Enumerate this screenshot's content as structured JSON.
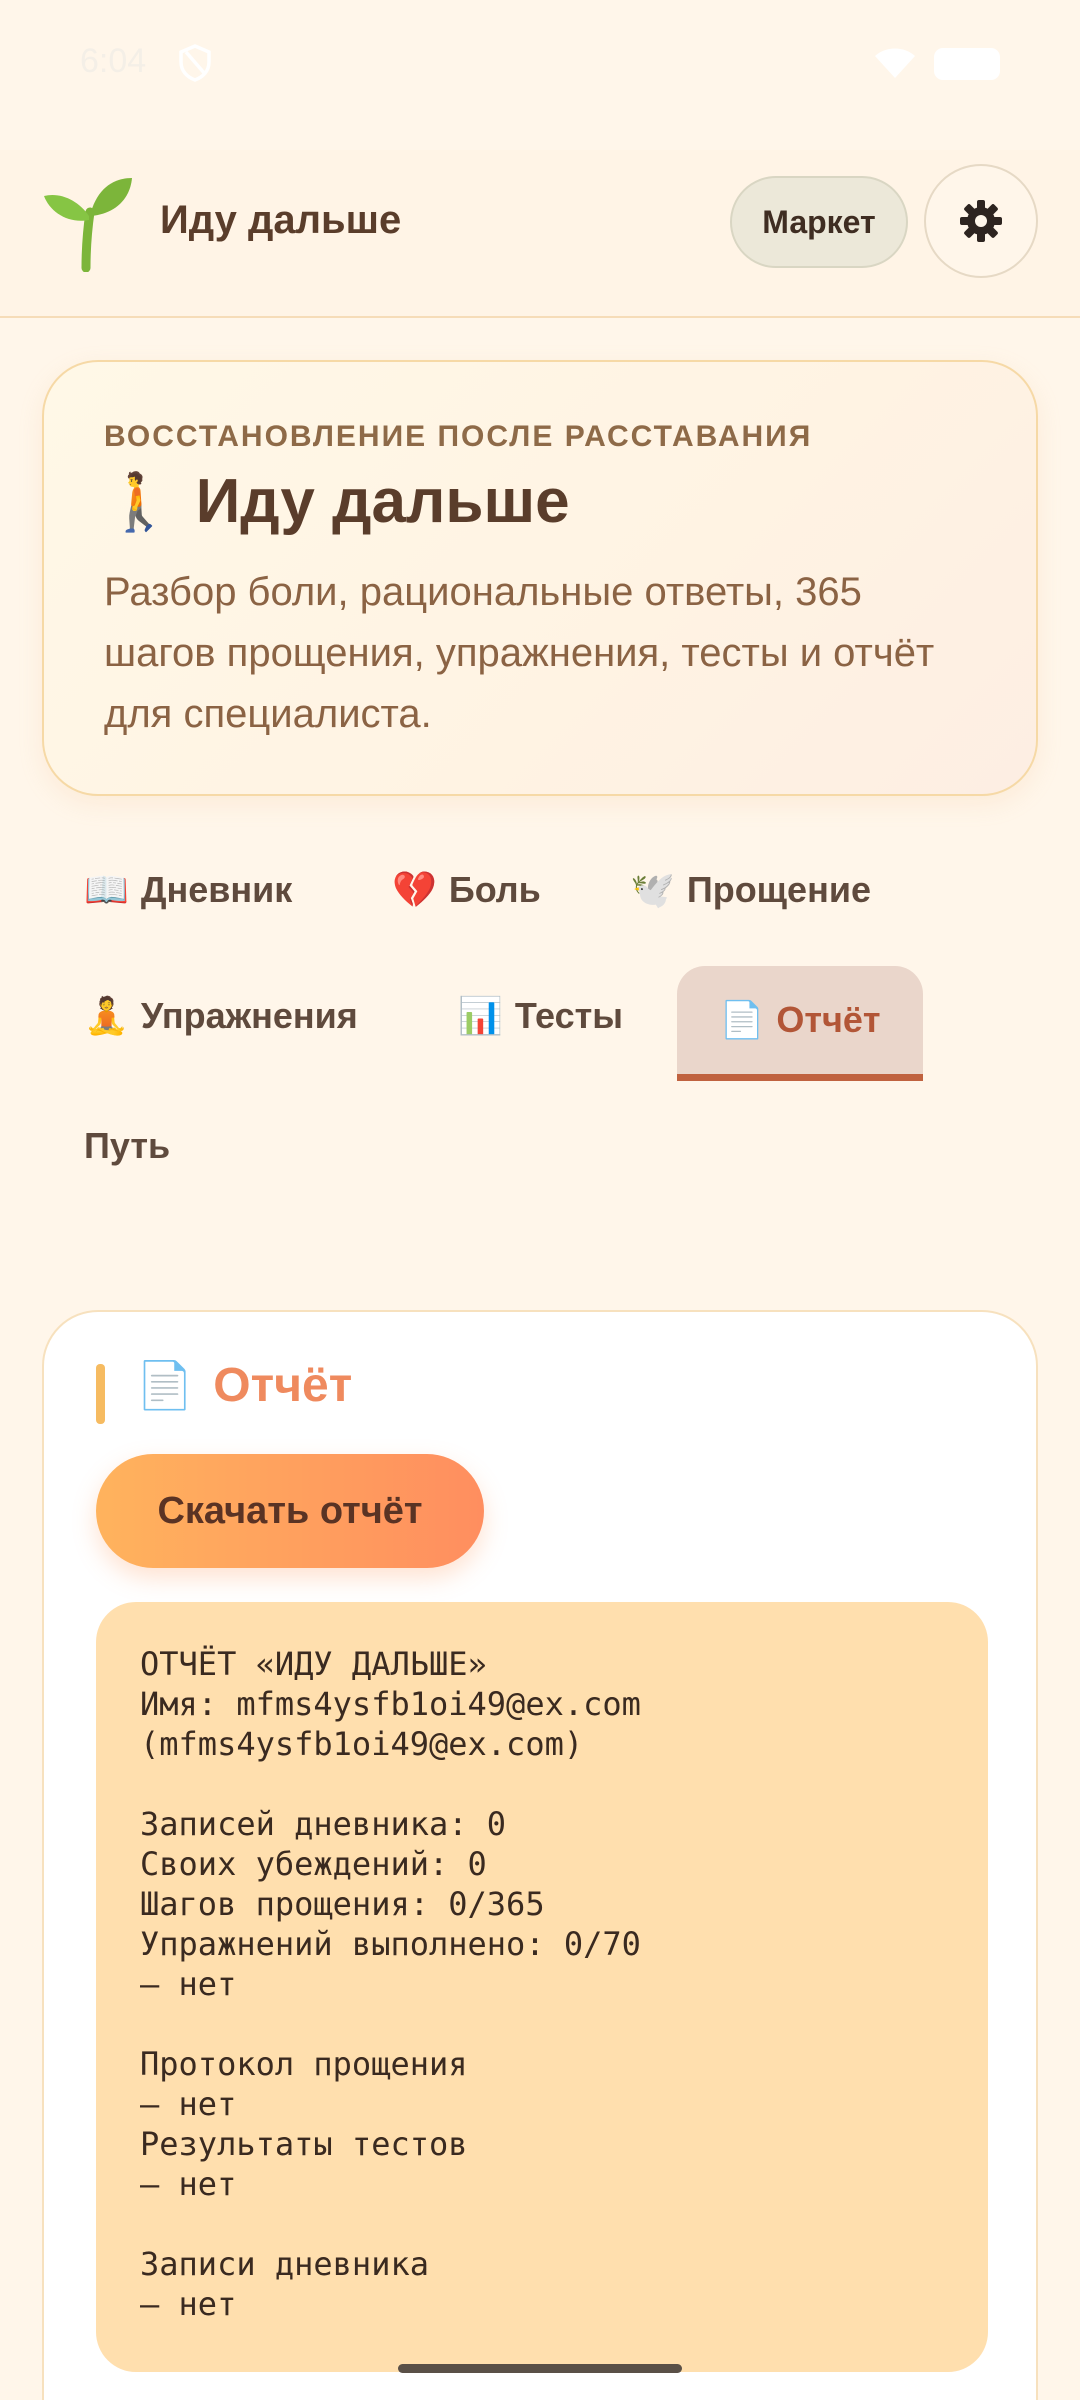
{
  "status": {
    "time": "6:04"
  },
  "appbar": {
    "title": "Иду дальше",
    "market_label": "Маркет",
    "logo_icon": "seedling-icon",
    "settings_icon": "gear-icon"
  },
  "hero": {
    "kicker": "ВОССТАНОВЛЕНИЕ ПОСЛЕ РАССТАВАНИЯ",
    "emoji": "🚶",
    "title": "Иду дальше",
    "description": "Разбор боли, рациональные ответы, 365 шагов прощения, упражнения, тесты и отчёт для специалиста."
  },
  "tabs": [
    {
      "icon": "📖",
      "label": "Дневник"
    },
    {
      "icon": "💔",
      "label": "Боль"
    },
    {
      "icon": "🕊️",
      "label": "Прощение"
    },
    {
      "icon": "🧘",
      "label": "Упражнения"
    },
    {
      "icon": "📊",
      "label": "Тесты"
    },
    {
      "icon": "📄",
      "label": "Отчёт",
      "active": true
    },
    {
      "icon": "",
      "label": "Путь"
    }
  ],
  "report_section": {
    "icon": "📄",
    "title": "Отчёт",
    "download_label": "Скачать отчёт",
    "lines": [
      "ОТЧЁТ «ИДУ ДАЛЬШЕ»",
      "Имя: mfms4ysfb1oi49@ex.com",
      "(mfms4ysfb1oi49@ex.com)",
      "",
      "Записей дневника: 0",
      "Своих убеждений: 0",
      "Шагов прощения: 0/365",
      "Упражнений выполнено: 0/70",
      "— нет",
      "",
      "Протокол прощения",
      "— нет",
      "Результаты тестов",
      "— нет",
      "",
      "Записи дневника",
      "— нет"
    ]
  },
  "colors": {
    "background": "#fff6ea",
    "accent": "#ef8a5e",
    "active_tab": "#b25637",
    "report_bg": "#ffdfae"
  }
}
